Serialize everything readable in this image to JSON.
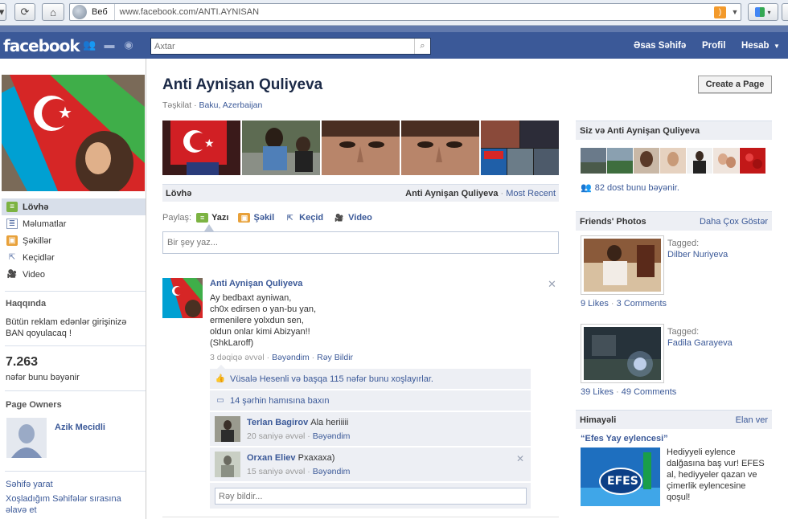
{
  "browser": {
    "scope_label": "Веб",
    "url": "www.facebook.com/ANTI.AYNISAN"
  },
  "topbar": {
    "logo": "facebook",
    "search_placeholder": "Axtar",
    "nav": [
      "Əsas Səhifə",
      "Profil",
      "Hesab"
    ]
  },
  "page": {
    "title": "Anti Aynişan Quliyeva",
    "category": "Təşkilat",
    "location": "Baku, Azerbaijan",
    "create_page_button": "Create a Page"
  },
  "left_nav": {
    "items": [
      {
        "label": "Lövhə",
        "icon": "wall-icon",
        "active": true
      },
      {
        "label": "Məlumatlar",
        "icon": "info-icon",
        "active": false
      },
      {
        "label": "Şəkillər",
        "icon": "photos-icon",
        "active": false
      },
      {
        "label": "Keçidlər",
        "icon": "links-icon",
        "active": false
      },
      {
        "label": "Video",
        "icon": "video-icon",
        "active": false
      }
    ],
    "about_heading": "Haqqında",
    "about_text": "Bütün reklam edənlər girişinizə BAN qoyulacaq !",
    "likes_count": "7.263",
    "likes_label": "nəfər bunu bəyənir",
    "owners_heading": "Page Owners",
    "owner_name": "Azik Mecidli",
    "footer_link_1": "Səhifə yarat",
    "footer_link_2": "Xoşladığım Səhifələr sırasına əlavə et"
  },
  "wall": {
    "tab_label": "Lövhə",
    "filter_name": "Anti Aynişan Quliyeva",
    "filter_sep": " · ",
    "filter_link": "Most Recent",
    "share_label": "Paylaş:",
    "share_items": [
      "Yazı",
      "Şəkil",
      "Keçid",
      "Video"
    ],
    "composer_placeholder": "Bir şey yaz..."
  },
  "post": {
    "author": "Anti Aynişan Quliyeva",
    "body": "Ay bedbaxt ayniwan,\nch0x edirsen o yan-bu yan,\nermenilere yolxdun sen,\noldun onlar kimi Abizyan!!\n(ShkLaroff)",
    "time": "3 dəqiqə əvvəl",
    "like_action": "Bəyəndim",
    "comment_action": "Rəy Bildir",
    "likes_summary": "Vüsalə Hesenli və başqa 115 nəfər bunu xoşlayırlar.",
    "view_comments": "14 şərhin hamısına baxın",
    "comments": [
      {
        "name": "Terlan Bagirov",
        "text": "Ala heriiiii",
        "time": "20 saniyə əvvəl",
        "like": "Bəyəndim"
      },
      {
        "name": "Orxan Eliev",
        "text": "Pxaxaxa)",
        "time": "15 saniyə əvvəl",
        "like": "Bəyəndim"
      }
    ],
    "comment_placeholder": "Rəy bildir..."
  },
  "right": {
    "mutual_heading": "Siz və Anti Aynişan Quliyeva",
    "friends_like": "82 dost bunu bəyənir.",
    "friends_photos_heading": "Friends' Photos",
    "friends_photos_link": "Daha Çox Göstər",
    "photos": [
      {
        "tagged_label": "Tagged:",
        "tagged_name": "Dilber Nuriyeva",
        "likes": "9 Likes",
        "comments": "3 Comments"
      },
      {
        "tagged_label": "Tagged:",
        "tagged_name": "Fadila Garayeva",
        "likes": "39 Likes",
        "comments": "49 Comments"
      }
    ],
    "sponsored_heading": "Himayəli",
    "sponsored_link": "Elan ver",
    "ad_title": "“Efes Yay eylencesi”",
    "ad_text": "Hediyyeli eylence dalğasına baş vur! EFES al, hediyyeler qazan ve çimerlik eylencesine qoşul!",
    "ad_logo": "EFES"
  },
  "colors": {
    "fb_blue": "#3b5998",
    "link": "#3b5998",
    "panel": "#edeff4"
  }
}
